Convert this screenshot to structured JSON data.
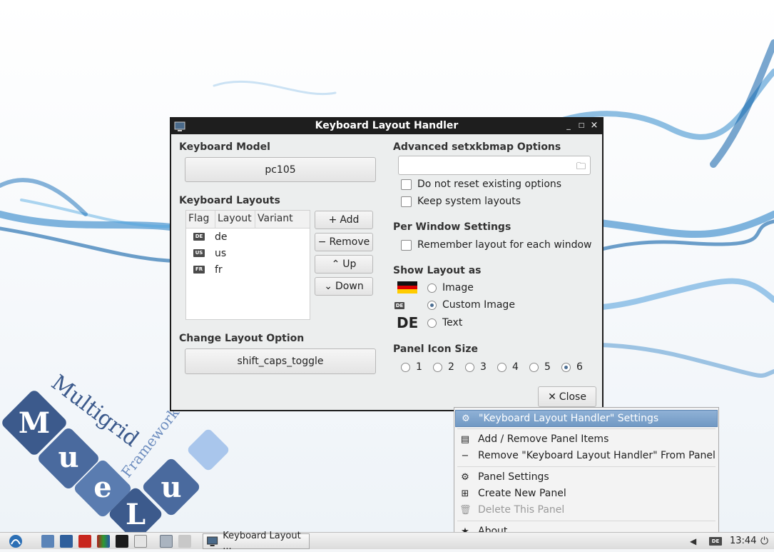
{
  "window": {
    "title": "Keyboard Layout Handler",
    "minimize_glyph": "_",
    "maximize_glyph": "□",
    "close_glyph": "×"
  },
  "keyboard_model": {
    "label": "Keyboard Model",
    "value": "pc105"
  },
  "keyboard_layouts": {
    "label": "Keyboard Layouts",
    "columns": [
      "Flag",
      "Layout",
      "Variant"
    ],
    "rows": [
      {
        "flag": "DE",
        "layout": "de",
        "variant": ""
      },
      {
        "flag": "US",
        "layout": "us",
        "variant": ""
      },
      {
        "flag": "FR",
        "layout": "fr",
        "variant": ""
      }
    ],
    "buttons": {
      "add": "Add",
      "remove": "Remove",
      "up": "Up",
      "down": "Down"
    }
  },
  "change_layout_option": {
    "label": "Change Layout Option",
    "value": "shift_caps_toggle"
  },
  "advanced": {
    "label": "Advanced setxkbmap Options",
    "value": "",
    "do_not_reset": "Do not reset existing options",
    "keep_system": "Keep system layouts"
  },
  "per_window": {
    "label": "Per Window Settings",
    "remember": "Remember layout for each window"
  },
  "show_layout": {
    "label": "Show Layout as",
    "options": [
      "Image",
      "Custom Image",
      "Text"
    ],
    "selected": "Custom Image",
    "custom_badge": "DE",
    "text_preview": "DE"
  },
  "panel_icon_size": {
    "label": "Panel Icon Size",
    "options": [
      "1",
      "2",
      "3",
      "4",
      "5",
      "6"
    ],
    "selected": "6"
  },
  "close_button": "Close",
  "context_menu": {
    "items": [
      {
        "label": "\"Keyboard Layout Handler\" Settings",
        "icon": "gear-icon"
      },
      {
        "label": "Add / Remove Panel Items",
        "icon": "list-icon"
      },
      {
        "label": "Remove \"Keyboard Layout Handler\" From Panel",
        "icon": "minus-icon"
      },
      {
        "label": "Panel Settings",
        "icon": "gear-icon"
      },
      {
        "label": "Create New Panel",
        "icon": "plus-box-icon"
      },
      {
        "label": "Delete This Panel",
        "icon": "trash-icon"
      },
      {
        "label": "About",
        "icon": "star-icon"
      }
    ]
  },
  "logo": {
    "letters": [
      "M",
      "u",
      "e",
      "L",
      "u"
    ],
    "line1": "Multigrid",
    "line2": "Framework"
  },
  "taskbar": {
    "task_label": "Keyboard Layout ...",
    "tray_badge": "DE",
    "clock": "13:44"
  },
  "colors": {
    "accent": "#7199c4",
    "titlebar": "#1e1e1e",
    "logo_blue": "#3c5a8c"
  }
}
